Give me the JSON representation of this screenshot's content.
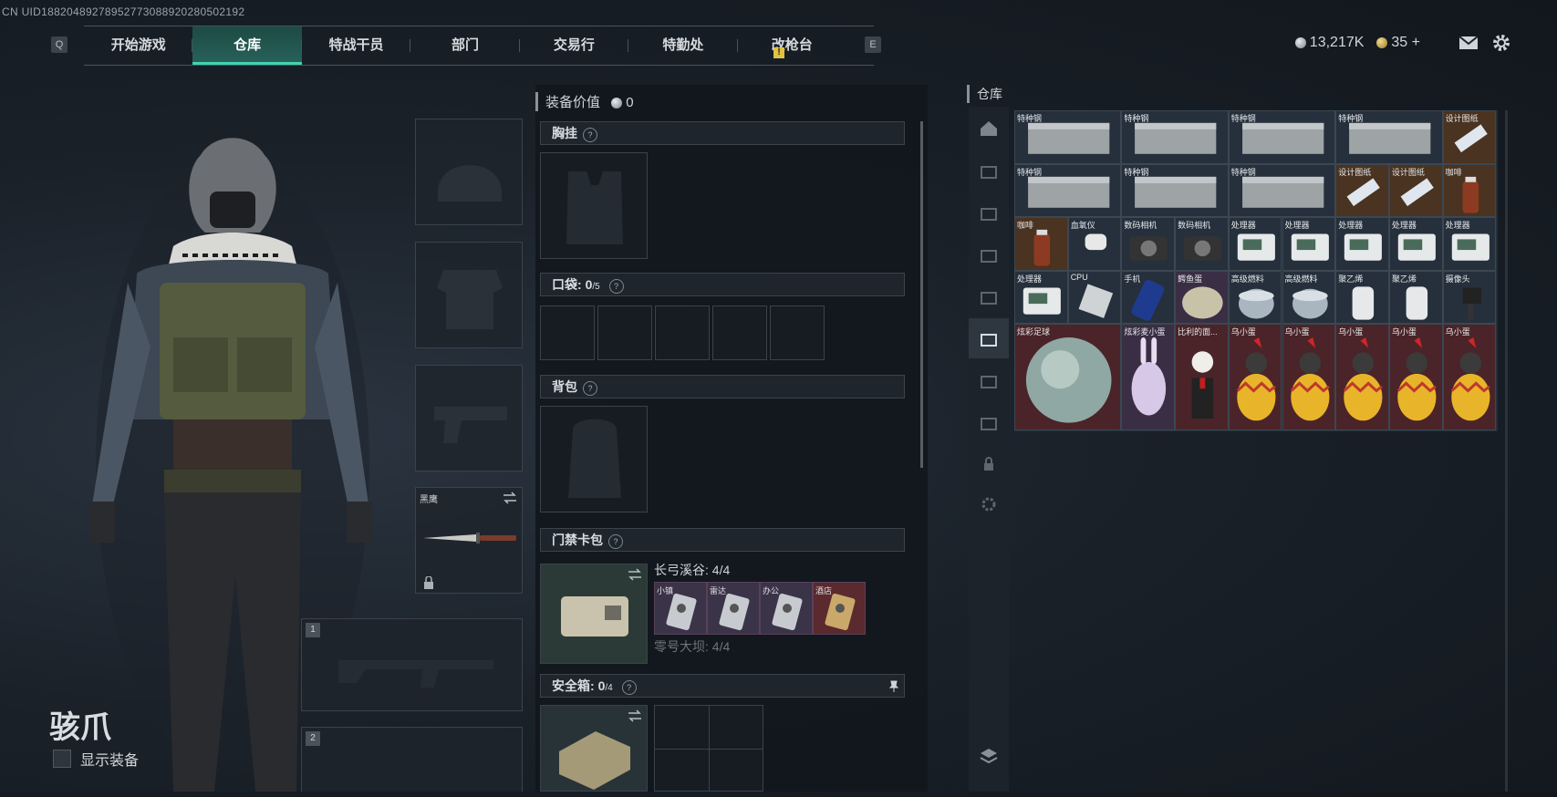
{
  "uid": "CN UID18820489278952773088920280502192",
  "nav": {
    "key_left": "Q",
    "key_right": "E",
    "tabs": [
      "开始游戏",
      "仓库",
      "特战干员",
      "部门",
      "交易行",
      "特勤处",
      "改枪台"
    ],
    "active_index": 1,
    "alert_badge": "!"
  },
  "topbar": {
    "currency1": "13,217K",
    "currency2": "35",
    "plus": "+"
  },
  "character": {
    "name": "骇爪",
    "show_equipment": "显示装备"
  },
  "slots": {
    "melee_label": "黑鹰",
    "weapon1": "1",
    "weapon2": "2"
  },
  "loadout": {
    "title": "装备价值",
    "value": "0",
    "chest_rig": "胸挂",
    "pocket": "口袋",
    "pocket_count": "0",
    "pocket_max": "/5",
    "backpack": "背包",
    "keycard": "门禁卡包",
    "keycard_map1": "长弓溪谷: 4/4",
    "keycard_map2": "零号大坝: 4/4",
    "cards": [
      "小镇",
      "雷达",
      "办公",
      "酒店"
    ],
    "secure": "安全箱",
    "secure_count": "0",
    "secure_max": "/4"
  },
  "warehouse": {
    "title": "仓库",
    "items": [
      {
        "label": "特种钢",
        "c": 0,
        "r": 0,
        "w": 2,
        "h": 1,
        "kind": "steel"
      },
      {
        "label": "特种钢",
        "c": 2,
        "r": 0,
        "w": 2,
        "h": 1,
        "kind": "steel"
      },
      {
        "label": "特种钢",
        "c": 4,
        "r": 0,
        "w": 2,
        "h": 1,
        "kind": "steel"
      },
      {
        "label": "特种钢",
        "c": 6,
        "r": 0,
        "w": 2,
        "h": 1,
        "kind": "steel"
      },
      {
        "label": "设计图纸",
        "c": 8,
        "r": 0,
        "w": 1,
        "h": 1,
        "kind": "blueprint"
      },
      {
        "label": "特种钢",
        "c": 0,
        "r": 1,
        "w": 2,
        "h": 1,
        "kind": "steel"
      },
      {
        "label": "特种钢",
        "c": 2,
        "r": 1,
        "w": 2,
        "h": 1,
        "kind": "steel"
      },
      {
        "label": "特种钢",
        "c": 4,
        "r": 1,
        "w": 2,
        "h": 1,
        "kind": "steel"
      },
      {
        "label": "设计图纸",
        "c": 6,
        "r": 1,
        "w": 1,
        "h": 1,
        "kind": "blueprint"
      },
      {
        "label": "设计图纸",
        "c": 7,
        "r": 1,
        "w": 1,
        "h": 1,
        "kind": "blueprint"
      },
      {
        "label": "咖啡",
        "c": 8,
        "r": 1,
        "w": 1,
        "h": 1,
        "kind": "coffee"
      },
      {
        "label": "咖啡",
        "c": 0,
        "r": 2,
        "w": 1,
        "h": 1,
        "kind": "coffee"
      },
      {
        "label": "血氧仪",
        "c": 1,
        "r": 2,
        "w": 1,
        "h": 1,
        "kind": "oxi"
      },
      {
        "label": "数码相机",
        "c": 2,
        "r": 2,
        "w": 1,
        "h": 1,
        "kind": "camera"
      },
      {
        "label": "数码相机",
        "c": 3,
        "r": 2,
        "w": 1,
        "h": 1,
        "kind": "camera"
      },
      {
        "label": "处理器",
        "c": 4,
        "r": 2,
        "w": 1,
        "h": 1,
        "kind": "device"
      },
      {
        "label": "处理器",
        "c": 5,
        "r": 2,
        "w": 1,
        "h": 1,
        "kind": "device"
      },
      {
        "label": "处理器",
        "c": 6,
        "r": 2,
        "w": 1,
        "h": 1,
        "kind": "device"
      },
      {
        "label": "处理器",
        "c": 7,
        "r": 2,
        "w": 1,
        "h": 1,
        "kind": "device"
      },
      {
        "label": "处理器",
        "c": 8,
        "r": 2,
        "w": 1,
        "h": 1,
        "kind": "device"
      },
      {
        "label": "处理器",
        "c": 0,
        "r": 3,
        "w": 1,
        "h": 1,
        "kind": "device"
      },
      {
        "label": "CPU",
        "c": 1,
        "r": 3,
        "w": 1,
        "h": 1,
        "kind": "cpu"
      },
      {
        "label": "手机",
        "c": 2,
        "r": 3,
        "w": 1,
        "h": 1,
        "kind": "phone"
      },
      {
        "label": "鳄鱼蛋",
        "c": 3,
        "r": 3,
        "w": 1,
        "h": 1,
        "kind": "egg"
      },
      {
        "label": "高级燃料",
        "c": 4,
        "r": 3,
        "w": 1,
        "h": 1,
        "kind": "fuel"
      },
      {
        "label": "高级燃料",
        "c": 5,
        "r": 3,
        "w": 1,
        "h": 1,
        "kind": "fuel"
      },
      {
        "label": "聚乙烯",
        "c": 6,
        "r": 3,
        "w": 1,
        "h": 1,
        "kind": "roll"
      },
      {
        "label": "聚乙烯",
        "c": 7,
        "r": 3,
        "w": 1,
        "h": 1,
        "kind": "roll"
      },
      {
        "label": "摄像头",
        "c": 8,
        "r": 3,
        "w": 1,
        "h": 1,
        "kind": "cam2"
      },
      {
        "label": "炫彩足球",
        "c": 0,
        "r": 4,
        "w": 2,
        "h": 2,
        "kind": "ball"
      },
      {
        "label": "炫彩麦小蛋",
        "c": 2,
        "r": 4,
        "w": 1,
        "h": 2,
        "kind": "bunny"
      },
      {
        "label": "比利的面...",
        "c": 3,
        "r": 4,
        "w": 1,
        "h": 2,
        "kind": "puppet"
      },
      {
        "label": "乌小蛋",
        "c": 4,
        "r": 4,
        "w": 1,
        "h": 2,
        "kind": "rooster"
      },
      {
        "label": "乌小蛋",
        "c": 5,
        "r": 4,
        "w": 1,
        "h": 2,
        "kind": "rooster"
      },
      {
        "label": "乌小蛋",
        "c": 6,
        "r": 4,
        "w": 1,
        "h": 2,
        "kind": "rooster"
      },
      {
        "label": "乌小蛋",
        "c": 7,
        "r": 4,
        "w": 1,
        "h": 2,
        "kind": "rooster"
      },
      {
        "label": "乌小蛋",
        "c": 8,
        "r": 4,
        "w": 1,
        "h": 2,
        "kind": "rooster"
      }
    ]
  },
  "colors": {
    "accent": "#40d3b2",
    "gold_cell": "#4a3320",
    "purple_cell": "#3a2e44",
    "red_cell": "#4a2428",
    "blue_cell": "#26303c"
  }
}
